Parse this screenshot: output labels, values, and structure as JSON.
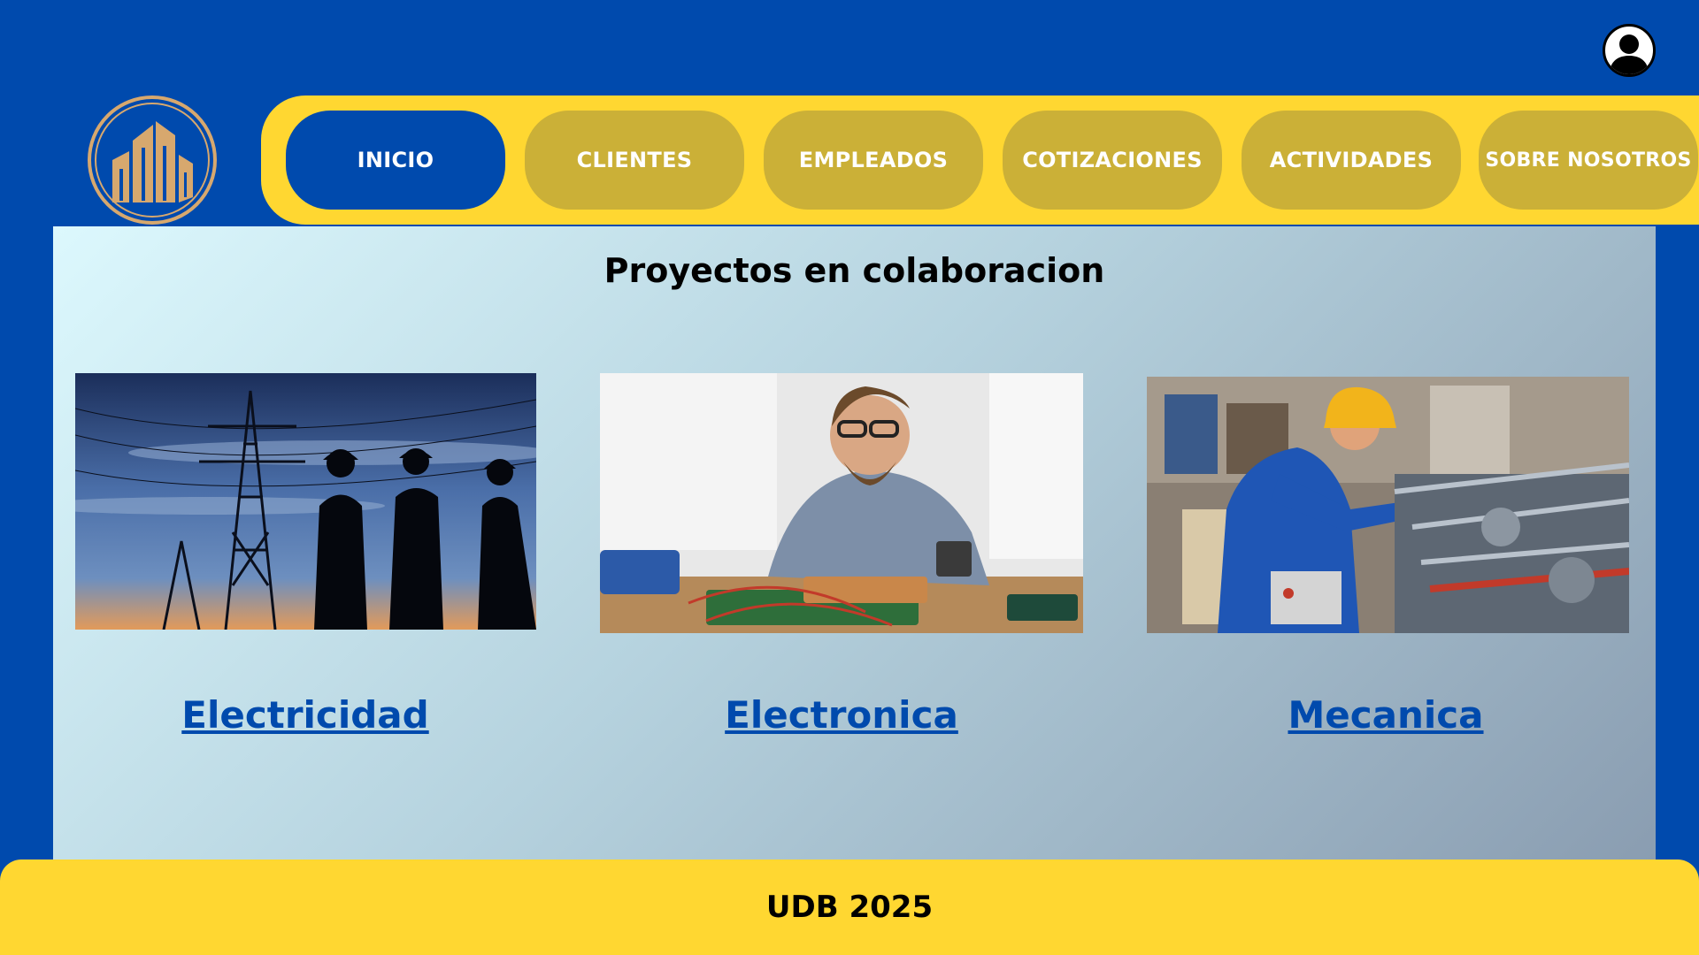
{
  "header": {
    "avatar_icon": "user-icon",
    "logo_icon": "buildings-logo"
  },
  "nav": {
    "items": [
      {
        "label": "INICIO",
        "active": true
      },
      {
        "label": "CLIENTES",
        "active": false
      },
      {
        "label": "EMPLEADOS",
        "active": false
      },
      {
        "label": "COTIZACIONES",
        "active": false
      },
      {
        "label": "ACTIVIDADES",
        "active": false
      },
      {
        "label": "SOBRE NOSOTROS",
        "active": false
      }
    ]
  },
  "main": {
    "title": "Proyectos en colaboracion",
    "cards": [
      {
        "label": "Electricidad",
        "image": "power-line-workers-silhouette"
      },
      {
        "label": "Electronica",
        "image": "technician-soldering-circuit-board"
      },
      {
        "label": "Mecanica",
        "image": "worker-operating-machinery"
      }
    ]
  },
  "footer": {
    "text": "UDB 2025"
  },
  "colors": {
    "primary_blue": "#004aad",
    "yellow": "#ffd731",
    "nav_gold": "#cbb037",
    "logo_gold": "#d7a86e"
  }
}
